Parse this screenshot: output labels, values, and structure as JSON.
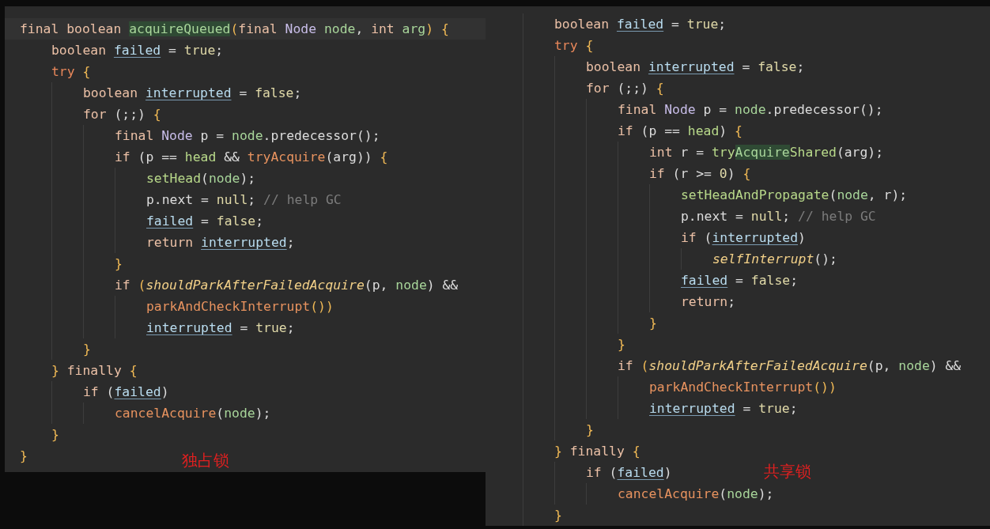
{
  "panels": [
    {
      "annotation": "独占锁",
      "lines": [
        {
          "current": true,
          "tokens": [
            {
              "text": "final boolean ",
              "kind": "kw"
            },
            {
              "text": "acquireQueued",
              "kind": "match"
            },
            {
              "text": "(",
              "kind": "brace"
            },
            {
              "text": "final ",
              "kind": "kw"
            },
            {
              "text": "Node ",
              "kind": "type"
            },
            {
              "text": "node",
              "kind": "param"
            },
            {
              "text": ", ",
              "kind": "p"
            },
            {
              "text": "int ",
              "kind": "kw"
            },
            {
              "text": "arg",
              "kind": "param"
            },
            {
              "text": ") {",
              "kind": "brace"
            }
          ],
          "children": [
            {
              "tokens": [
                {
                  "text": "boolean ",
                  "kind": "kw"
                },
                {
                  "text": "failed",
                  "kind": "field"
                },
                {
                  "text": " = ",
                  "kind": "p"
                },
                {
                  "text": "true",
                  "kind": "lit"
                },
                {
                  "text": ";",
                  "kind": "p"
                }
              ]
            },
            {
              "tokens": [
                {
                  "text": "try ",
                  "kind": "ctrl"
                },
                {
                  "text": "{",
                  "kind": "brace"
                }
              ],
              "children": [
                {
                  "tokens": [
                    {
                      "text": "boolean ",
                      "kind": "kw"
                    },
                    {
                      "text": "interrupted",
                      "kind": "field"
                    },
                    {
                      "text": " = ",
                      "kind": "p"
                    },
                    {
                      "text": "false",
                      "kind": "lit"
                    },
                    {
                      "text": ";",
                      "kind": "p"
                    }
                  ]
                },
                {
                  "tokens": [
                    {
                      "text": "for ",
                      "kind": "kw"
                    },
                    {
                      "text": "(;;) ",
                      "kind": "p"
                    },
                    {
                      "text": "{",
                      "kind": "brace"
                    }
                  ],
                  "children": [
                    {
                      "tokens": [
                        {
                          "text": "final ",
                          "kind": "kw"
                        },
                        {
                          "text": "Node ",
                          "kind": "type"
                        },
                        {
                          "text": "p = ",
                          "kind": "p"
                        },
                        {
                          "text": "node",
                          "kind": "param"
                        },
                        {
                          "text": ".predecessor();",
                          "kind": "p"
                        }
                      ]
                    },
                    {
                      "tokens": [
                        {
                          "text": "if ",
                          "kind": "kw"
                        },
                        {
                          "text": "(p == ",
                          "kind": "p"
                        },
                        {
                          "text": "head",
                          "kind": "call"
                        },
                        {
                          "text": " && ",
                          "kind": "p"
                        },
                        {
                          "text": "tryAcquire",
                          "kind": "fn"
                        },
                        {
                          "text": "(arg)) ",
                          "kind": "p"
                        },
                        {
                          "text": "{",
                          "kind": "brace"
                        }
                      ],
                      "children": [
                        {
                          "tokens": [
                            {
                              "text": "setHead",
                              "kind": "call"
                            },
                            {
                              "text": "(",
                              "kind": "p"
                            },
                            {
                              "text": "node",
                              "kind": "param"
                            },
                            {
                              "text": ");",
                              "kind": "p"
                            }
                          ]
                        },
                        {
                          "tokens": [
                            {
                              "text": "p.next = ",
                              "kind": "p"
                            },
                            {
                              "text": "null",
                              "kind": "lit"
                            },
                            {
                              "text": "; ",
                              "kind": "p"
                            },
                            {
                              "text": "// help GC",
                              "kind": "comment"
                            }
                          ]
                        },
                        {
                          "tokens": [
                            {
                              "text": "failed",
                              "kind": "field"
                            },
                            {
                              "text": " = ",
                              "kind": "p"
                            },
                            {
                              "text": "false",
                              "kind": "lit"
                            },
                            {
                              "text": ";",
                              "kind": "p"
                            }
                          ]
                        },
                        {
                          "tokens": [
                            {
                              "text": "return ",
                              "kind": "kw"
                            },
                            {
                              "text": "interrupted",
                              "kind": "field"
                            },
                            {
                              "text": ";",
                              "kind": "p"
                            }
                          ]
                        }
                      ]
                    },
                    {
                      "tokens": [
                        {
                          "text": "}",
                          "kind": "brace"
                        }
                      ]
                    },
                    {
                      "tokens": [
                        {
                          "text": "if ",
                          "kind": "kw"
                        },
                        {
                          "text": "(",
                          "kind": "brace"
                        },
                        {
                          "text": "shouldParkAfterFailedAcquire",
                          "kind": "static"
                        },
                        {
                          "text": "(p, ",
                          "kind": "p"
                        },
                        {
                          "text": "node",
                          "kind": "param"
                        },
                        {
                          "text": ") &&",
                          "kind": "p"
                        }
                      ],
                      "children": [
                        {
                          "tokens": [
                            {
                              "text": "parkAndCheckInterrupt",
                              "kind": "fn"
                            },
                            {
                              "text": "())",
                              "kind": "brace"
                            }
                          ]
                        },
                        {
                          "tokens": [
                            {
                              "text": "interrupted",
                              "kind": "field"
                            },
                            {
                              "text": " = ",
                              "kind": "p"
                            },
                            {
                              "text": "true",
                              "kind": "lit"
                            },
                            {
                              "text": ";",
                              "kind": "p"
                            }
                          ]
                        }
                      ]
                    }
                  ]
                },
                {
                  "tokens": [
                    {
                      "text": "}",
                      "kind": "brace"
                    }
                  ]
                }
              ]
            },
            {
              "tokens": [
                {
                  "text": "} ",
                  "kind": "brace"
                },
                {
                  "text": "finally ",
                  "kind": "kw"
                },
                {
                  "text": "{",
                  "kind": "brace"
                }
              ],
              "children": [
                {
                  "tokens": [
                    {
                      "text": "if ",
                      "kind": "kw"
                    },
                    {
                      "text": "(",
                      "kind": "p"
                    },
                    {
                      "text": "failed",
                      "kind": "field"
                    },
                    {
                      "text": ")",
                      "kind": "p"
                    }
                  ],
                  "children": [
                    {
                      "tokens": [
                        {
                          "text": "cancelAcquire",
                          "kind": "fn"
                        },
                        {
                          "text": "(",
                          "kind": "p"
                        },
                        {
                          "text": "node",
                          "kind": "param"
                        },
                        {
                          "text": ");",
                          "kind": "p"
                        }
                      ]
                    }
                  ]
                }
              ]
            },
            {
              "tokens": [
                {
                  "text": "}",
                  "kind": "brace"
                }
              ]
            }
          ]
        },
        {
          "current": false,
          "tokens": [
            {
              "text": "}",
              "kind": "brace"
            }
          ]
        }
      ]
    },
    {
      "annotation": "共享锁",
      "lines": [
        {
          "tokens": [
            {
              "text": "boolean ",
              "kind": "kw"
            },
            {
              "text": "failed",
              "kind": "field"
            },
            {
              "text": " = ",
              "kind": "p"
            },
            {
              "text": "true",
              "kind": "lit"
            },
            {
              "text": ";",
              "kind": "p"
            }
          ]
        },
        {
          "tokens": [
            {
              "text": "try ",
              "kind": "ctrl"
            },
            {
              "text": "{",
              "kind": "brace"
            }
          ],
          "children": [
            {
              "tokens": [
                {
                  "text": "boolean ",
                  "kind": "kw"
                },
                {
                  "text": "interrupted",
                  "kind": "field"
                },
                {
                  "text": " = ",
                  "kind": "p"
                },
                {
                  "text": "false",
                  "kind": "lit"
                },
                {
                  "text": ";",
                  "kind": "p"
                }
              ]
            },
            {
              "tokens": [
                {
                  "text": "for ",
                  "kind": "kw"
                },
                {
                  "text": "(;;) ",
                  "kind": "p"
                },
                {
                  "text": "{",
                  "kind": "brace"
                }
              ],
              "children": [
                {
                  "tokens": [
                    {
                      "text": "final ",
                      "kind": "kw"
                    },
                    {
                      "text": "Node ",
                      "kind": "type"
                    },
                    {
                      "text": "p = ",
                      "kind": "p"
                    },
                    {
                      "text": "node",
                      "kind": "param"
                    },
                    {
                      "text": ".predecessor();",
                      "kind": "p"
                    }
                  ]
                },
                {
                  "tokens": [
                    {
                      "text": "if ",
                      "kind": "kw"
                    },
                    {
                      "text": "(p == ",
                      "kind": "p"
                    },
                    {
                      "text": "head",
                      "kind": "call"
                    },
                    {
                      "text": ") ",
                      "kind": "p"
                    },
                    {
                      "text": "{",
                      "kind": "brace"
                    }
                  ],
                  "children": [
                    {
                      "tokens": [
                        {
                          "text": "int ",
                          "kind": "kw"
                        },
                        {
                          "text": "r = ",
                          "kind": "p"
                        },
                        {
                          "text": "try",
                          "kind": "call"
                        },
                        {
                          "text": "Acquire",
                          "kind": "match"
                        },
                        {
                          "text": "Shared",
                          "kind": "call"
                        },
                        {
                          "text": "(arg);",
                          "kind": "p"
                        }
                      ]
                    },
                    {
                      "tokens": [
                        {
                          "text": "if ",
                          "kind": "kw"
                        },
                        {
                          "text": "(r >= ",
                          "kind": "p"
                        },
                        {
                          "text": "0",
                          "kind": "lit"
                        },
                        {
                          "text": ") ",
                          "kind": "p"
                        },
                        {
                          "text": "{",
                          "kind": "brace"
                        }
                      ],
                      "children": [
                        {
                          "tokens": [
                            {
                              "text": "setHeadAndPropagate",
                              "kind": "call"
                            },
                            {
                              "text": "(",
                              "kind": "p"
                            },
                            {
                              "text": "node",
                              "kind": "param"
                            },
                            {
                              "text": ", r);",
                              "kind": "p"
                            }
                          ]
                        },
                        {
                          "tokens": [
                            {
                              "text": "p.next = ",
                              "kind": "p"
                            },
                            {
                              "text": "null",
                              "kind": "lit"
                            },
                            {
                              "text": "; ",
                              "kind": "p"
                            },
                            {
                              "text": "// help GC",
                              "kind": "comment"
                            }
                          ]
                        },
                        {
                          "tokens": [
                            {
                              "text": "if ",
                              "kind": "kw"
                            },
                            {
                              "text": "(",
                              "kind": "p"
                            },
                            {
                              "text": "interrupted",
                              "kind": "field"
                            },
                            {
                              "text": ")",
                              "kind": "p"
                            }
                          ],
                          "children": [
                            {
                              "tokens": [
                                {
                                  "text": "selfInterrupt",
                                  "kind": "static"
                                },
                                {
                                  "text": "();",
                                  "kind": "p"
                                }
                              ]
                            }
                          ]
                        },
                        {
                          "tokens": [
                            {
                              "text": "failed",
                              "kind": "field"
                            },
                            {
                              "text": " = ",
                              "kind": "p"
                            },
                            {
                              "text": "false",
                              "kind": "lit"
                            },
                            {
                              "text": ";",
                              "kind": "p"
                            }
                          ]
                        },
                        {
                          "tokens": [
                            {
                              "text": "return",
                              "kind": "kw"
                            },
                            {
                              "text": ";",
                              "kind": "p"
                            }
                          ]
                        }
                      ]
                    },
                    {
                      "tokens": [
                        {
                          "text": "}",
                          "kind": "brace"
                        }
                      ]
                    }
                  ]
                },
                {
                  "tokens": [
                    {
                      "text": "}",
                      "kind": "brace"
                    }
                  ]
                },
                {
                  "tokens": [
                    {
                      "text": "if ",
                      "kind": "kw"
                    },
                    {
                      "text": "(",
                      "kind": "brace"
                    },
                    {
                      "text": "shouldParkAfterFailedAcquire",
                      "kind": "static"
                    },
                    {
                      "text": "(p, ",
                      "kind": "p"
                    },
                    {
                      "text": "node",
                      "kind": "param"
                    },
                    {
                      "text": ") &&",
                      "kind": "p"
                    }
                  ],
                  "children": [
                    {
                      "tokens": [
                        {
                          "text": "parkAndCheckInterrupt",
                          "kind": "fn"
                        },
                        {
                          "text": "())",
                          "kind": "brace"
                        }
                      ]
                    },
                    {
                      "tokens": [
                        {
                          "text": "interrupted",
                          "kind": "field"
                        },
                        {
                          "text": " = ",
                          "kind": "p"
                        },
                        {
                          "text": "true",
                          "kind": "lit"
                        },
                        {
                          "text": ";",
                          "kind": "p"
                        }
                      ]
                    }
                  ]
                }
              ]
            },
            {
              "tokens": [
                {
                  "text": "}",
                  "kind": "brace"
                }
              ]
            }
          ]
        },
        {
          "tokens": [
            {
              "text": "} ",
              "kind": "brace"
            },
            {
              "text": "finally ",
              "kind": "kw"
            },
            {
              "text": "{",
              "kind": "brace"
            }
          ],
          "children": [
            {
              "tokens": [
                {
                  "text": "if ",
                  "kind": "kw"
                },
                {
                  "text": "(",
                  "kind": "p"
                },
                {
                  "text": "failed",
                  "kind": "field"
                },
                {
                  "text": ")",
                  "kind": "p"
                }
              ],
              "children": [
                {
                  "tokens": [
                    {
                      "text": "cancelAcquire",
                      "kind": "fn"
                    },
                    {
                      "text": "(",
                      "kind": "p"
                    },
                    {
                      "text": "node",
                      "kind": "param"
                    },
                    {
                      "text": ");",
                      "kind": "p"
                    }
                  ]
                }
              ]
            }
          ]
        },
        {
          "tokens": [
            {
              "text": "}",
              "kind": "brace"
            }
          ]
        }
      ]
    }
  ]
}
